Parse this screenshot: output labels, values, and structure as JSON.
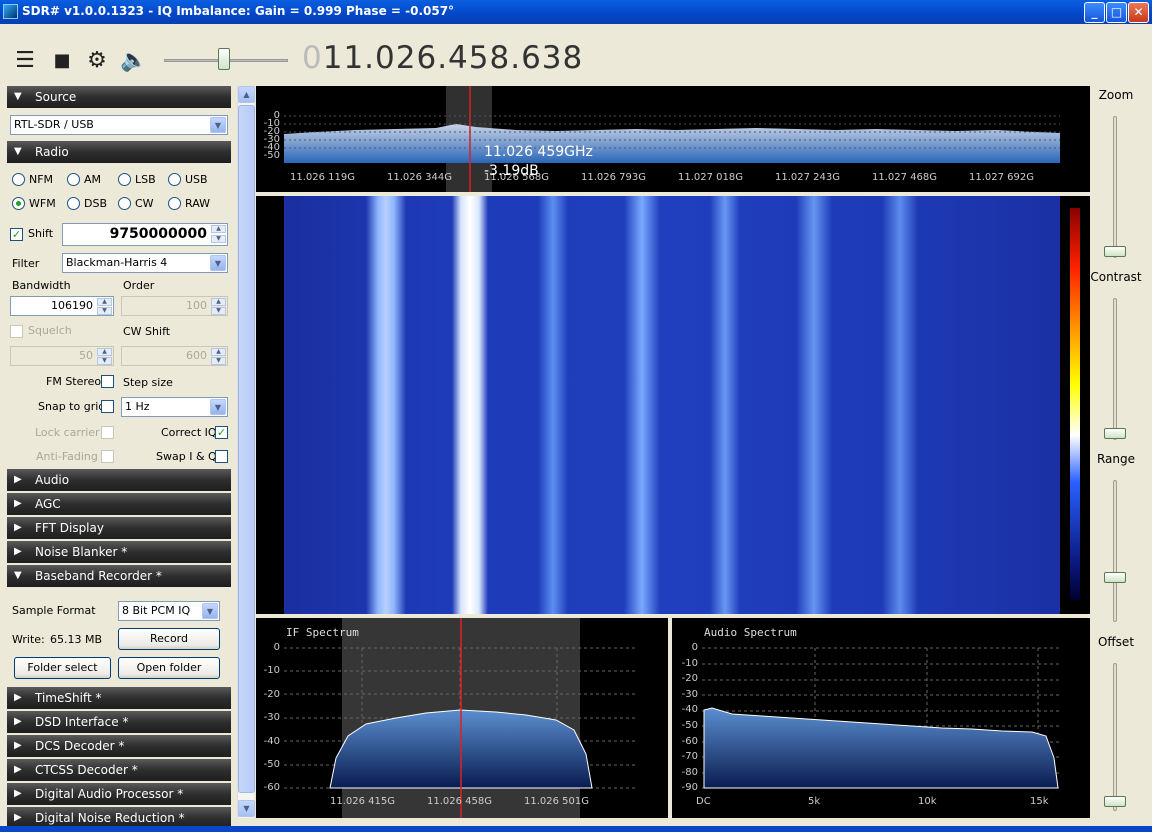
{
  "window": {
    "title": "SDR# v1.0.0.1323 - IQ Imbalance: Gain = 0.999 Phase = -0.057°"
  },
  "toolbar": {
    "frequency_lead": "0",
    "frequency": "11.026.458.638",
    "volume_level": 0.45
  },
  "panel": {
    "source": {
      "header": "Source",
      "device": "RTL-SDR / USB"
    },
    "radio": {
      "header": "Radio",
      "modes": [
        "NFM",
        "AM",
        "LSB",
        "USB",
        "WFM",
        "DSB",
        "CW",
        "RAW"
      ],
      "selected_mode": "WFM",
      "shift_label": "Shift",
      "shift_value": "9750000000",
      "filter_label": "Filter",
      "filter_value": "Blackman-Harris 4",
      "bandwidth_label": "Bandwidth",
      "bandwidth_value": "106190",
      "order_label": "Order",
      "order_value": "100",
      "squelch_label": "Squelch",
      "squelch_value": "50",
      "cwshift_label": "CW Shift",
      "cwshift_value": "600",
      "fmstereo_label": "FM Stereo",
      "stepsize_label": "Step size",
      "snap_label": "Snap to grid",
      "step_value": "1 Hz",
      "lockcarrier_label": "Lock carrier",
      "correctiq_label": "Correct IQ",
      "antifading_label": "Anti-Fading",
      "swapiq_label": "Swap I & Q"
    },
    "sections": [
      "Audio",
      "AGC",
      "FFT Display",
      "Noise Blanker *"
    ],
    "recorder": {
      "header": "Baseband Recorder *",
      "format_label": "Sample Format",
      "format_value": "8 Bit PCM IQ",
      "write_label": "Write:",
      "write_value": "65.13 MB",
      "record_button": "Record",
      "folder_select_button": "Folder select",
      "open_folder_button": "Open folder"
    },
    "sections_bottom": [
      "TimeShift *",
      "DSD Interface *",
      "DCS Decoder *",
      "CTCSS Decoder *",
      "Digital Audio Processor *",
      "Digital Noise Reduction *"
    ]
  },
  "spectrum": {
    "y_ticks": [
      "0",
      "-10",
      "-20",
      "-30",
      "-40",
      "-50"
    ],
    "x_ticks": [
      "11.026 119G",
      "11.026 344G",
      "11.026 568G",
      "11.026 793G",
      "11.027 018G",
      "11.027 243G",
      "11.027 468G",
      "11.027 692G"
    ],
    "cursor_freq": "11.026 459GHz",
    "cursor_level": "-3.19dB"
  },
  "if_spectrum": {
    "title": "IF Spectrum",
    "y_ticks": [
      "0",
      "-10",
      "-20",
      "-30",
      "-40",
      "-50",
      "-60"
    ],
    "x_ticks": [
      "11.026 415G",
      "11.026 458G",
      "11.026 501G"
    ]
  },
  "audio_spectrum": {
    "title": "Audio Spectrum",
    "y_ticks": [
      "0",
      "-10",
      "-20",
      "-30",
      "-40",
      "-50",
      "-60",
      "-70",
      "-80",
      "-90"
    ],
    "x_ticks": [
      "DC",
      "5k",
      "10k",
      "15k"
    ]
  },
  "right": {
    "zoom_label": "Zoom",
    "contrast_label": "Contrast",
    "range_label": "Range",
    "offset_label": "Offset"
  },
  "colors": {
    "accent_blue": "#0a5fe0",
    "spectrum_fill": "#3a6fb8",
    "cursor_red": "#e02020",
    "waterfall_bg": "#1a2fa0"
  }
}
